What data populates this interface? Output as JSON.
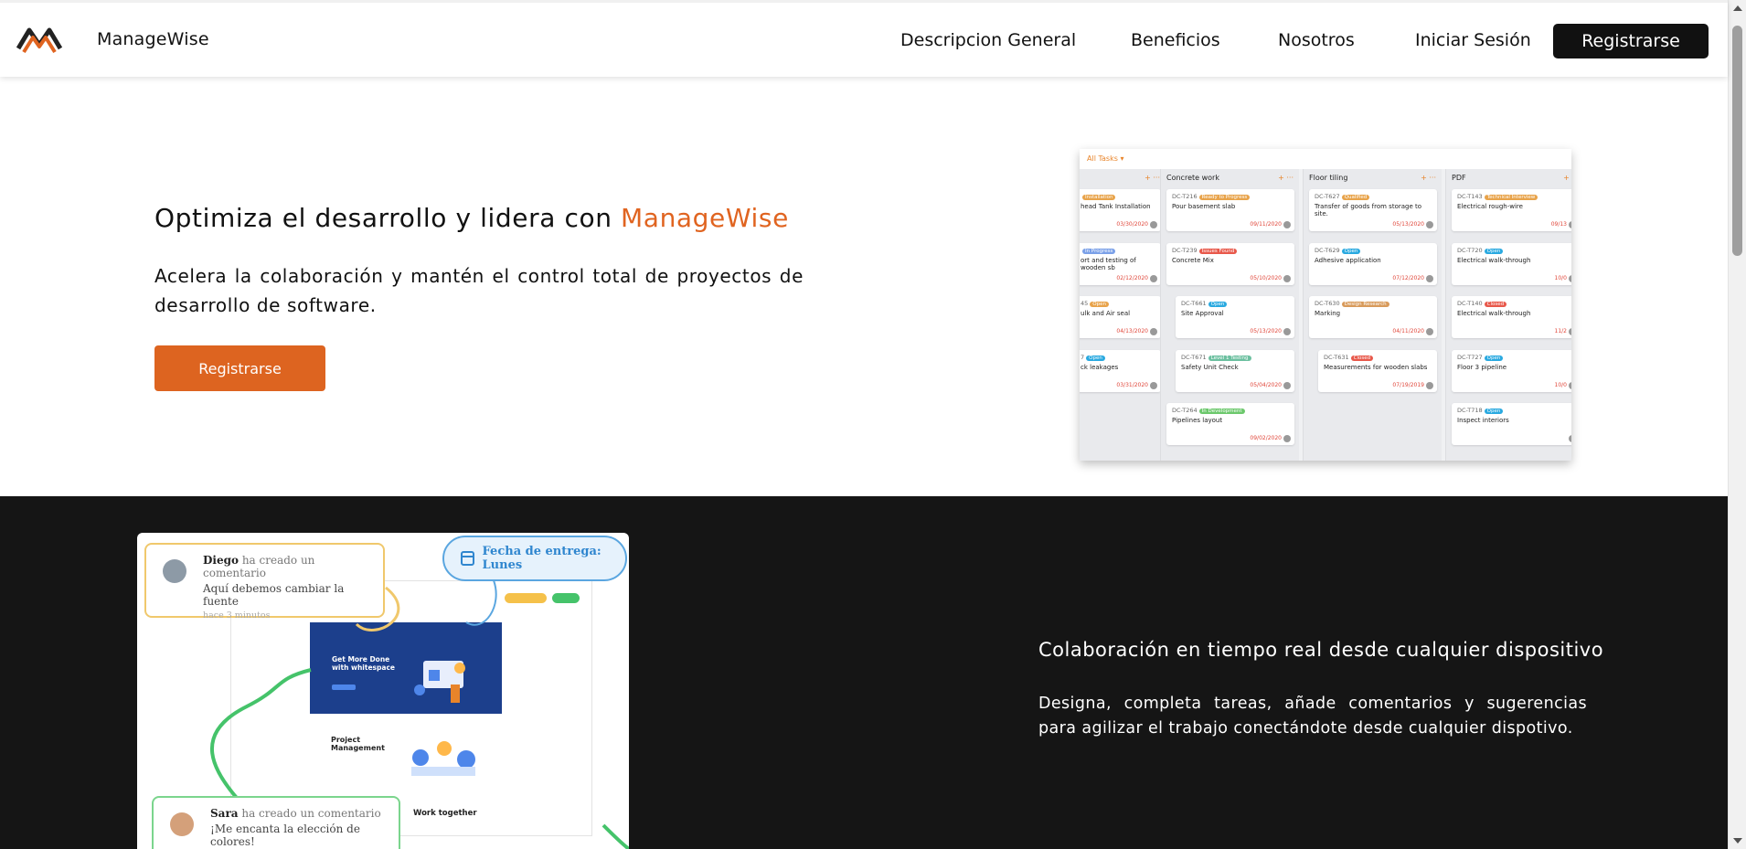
{
  "nav": {
    "brand": "ManageWise",
    "links": [
      "Descripcion General",
      "Beneficios",
      "Nosotros",
      "Iniciar Sesión"
    ],
    "register": "Registrarse"
  },
  "hero": {
    "title_prefix": "Optimiza el desarrollo y lidera con ",
    "title_accent": "ManageWise",
    "subtitle": "Acelera la colaboración y mantén el control total de proyectos de desarrollo de software.",
    "button": "Registrarse",
    "accent_color": "#e06420"
  },
  "kanban": {
    "all_tasks": "All Tasks ▾",
    "columns": [
      {
        "name": "",
        "cards": [
          {
            "id": "",
            "tag": "Installation",
            "tag_color": "#e8a34a",
            "title": "head Tank Installation",
            "date": "03/30/2020"
          },
          {
            "id": "",
            "tag": "In Progress",
            "tag_color": "#7aa0e8",
            "title": "ort and testing of wooden sb",
            "date": "02/12/2020"
          },
          {
            "id": "45",
            "tag": "Open",
            "tag_color": "#e8a34a",
            "title": "ulk and Air seal",
            "date": "04/13/2020"
          },
          {
            "id": "7",
            "tag": "Open",
            "tag_color": "#29a9e0",
            "title": "ck leakages",
            "date": "03/31/2020"
          }
        ]
      },
      {
        "name": "Concrete work",
        "cards": [
          {
            "id": "DC-T216",
            "tag": "Ready to Progress",
            "tag_color": "#e8a34a",
            "title": "Pour basement slab",
            "date": "09/11/2020"
          },
          {
            "id": "DC-T239",
            "tag": "Issues Found",
            "tag_color": "#e8584a",
            "title": "Concrete Mix",
            "date": "05/10/2020"
          },
          {
            "id": "DC-T661",
            "tag": "Open",
            "tag_color": "#29a9e0",
            "title": "Site Approval",
            "date": "05/13/2020"
          },
          {
            "id": "DC-T671",
            "tag": "Level 1 Testing",
            "tag_color": "#6cc0a0",
            "title": "Safety Unit Check",
            "date": "05/04/2020"
          },
          {
            "id": "DC-T264",
            "tag": "In Development",
            "tag_color": "#6cc86c",
            "title": "Pipelines layout",
            "date": "09/02/2020"
          }
        ]
      },
      {
        "name": "Floor tiling",
        "cards": [
          {
            "id": "DC-T627",
            "tag": "Qualified",
            "tag_color": "#e8a34a",
            "title": "Transfer of goods from storage to site.",
            "date": "05/13/2020"
          },
          {
            "id": "DC-T629",
            "tag": "Open",
            "tag_color": "#29a9e0",
            "title": "Adhesive application",
            "date": "07/12/2020"
          },
          {
            "id": "DC-T630",
            "tag": "Design Research",
            "tag_color": "#d89a5a",
            "title": "Marking",
            "date": "04/11/2020"
          },
          {
            "id": "DC-T631",
            "tag": "Closed",
            "tag_color": "#e8584a",
            "title": "Measurements for wooden slabs",
            "date": "07/19/2019"
          }
        ]
      },
      {
        "name": "PDF",
        "cards": [
          {
            "id": "DC-T143",
            "tag": "Technical Interview",
            "tag_color": "#e8a34a",
            "title": "Electrical rough-wire",
            "date": "09/13"
          },
          {
            "id": "DC-T720",
            "tag": "Open",
            "tag_color": "#29a9e0",
            "title": "Electrical walk-through",
            "date": "10/0"
          },
          {
            "id": "DC-T140",
            "tag": "Closed",
            "tag_color": "#e8584a",
            "title": "Electrical walk-through",
            "date": "11/2"
          },
          {
            "id": "DC-T727",
            "tag": "Open",
            "tag_color": "#29a9e0",
            "title": "Floor 3 pipeline",
            "date": "10/0"
          },
          {
            "id": "DC-T718",
            "tag": "Open",
            "tag_color": "#29a9e0",
            "title": "Inspect interiors",
            "date": ""
          }
        ]
      }
    ]
  },
  "collab_image": {
    "comment1": {
      "name": "Diego",
      "action": " ha creado un comentario",
      "message": "Aquí debemos cambiar la fuente",
      "ago": "hace 3 minutos"
    },
    "due": "Fecha de entrega: Lunes",
    "mock_title": "Get More Done with whitespace",
    "mock_pm": "Project Management",
    "mock_work": "Work together",
    "comment2": {
      "name": "Sara",
      "action": " ha creado un comentario",
      "message": "¡Me encanta la elección de colores!"
    }
  },
  "feature": {
    "title": "Colaboración en tiempo real desde cualquier dispositivo",
    "text": "Designa, completa tareas, añade comentarios y sugerencias para agilizar el trabajo conectándote desde cualquier dispotivo."
  }
}
